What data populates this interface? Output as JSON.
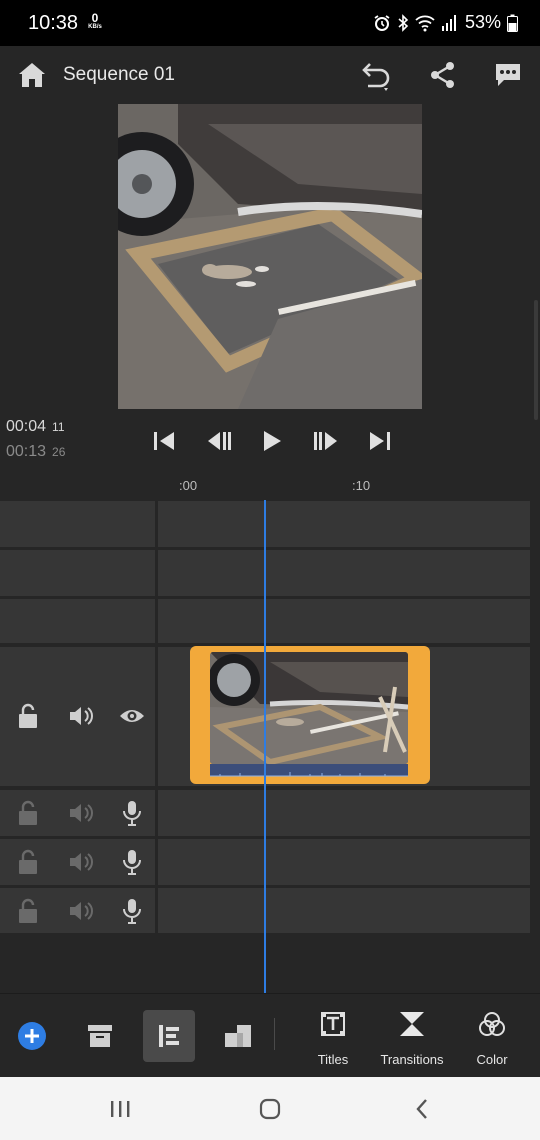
{
  "status_bar": {
    "time": "10:38",
    "net_speed": "0",
    "net_unit": "KB/s",
    "battery": "53%",
    "icons": [
      "alarm-icon",
      "bluetooth-icon",
      "wifi-icon",
      "signal-icon",
      "battery-icon"
    ]
  },
  "app_bar": {
    "title": "Sequence 01",
    "icons": [
      "home-icon",
      "undo-icon",
      "share-icon",
      "comment-icon"
    ]
  },
  "preview": {
    "current_time": "00:04",
    "current_frame": "11",
    "total_time": "00:13",
    "total_frame": "26",
    "transport_icons": [
      "skip-to-start-icon",
      "step-back-icon",
      "play-icon",
      "step-forward-icon",
      "skip-to-end-icon"
    ]
  },
  "ruler": {
    "ticks": [
      ":00",
      ":10"
    ]
  },
  "timeline": {
    "playhead_position_seconds": 4.4,
    "video_track_icons": [
      "lock-icon",
      "speaker-icon",
      "eye-icon"
    ],
    "audio_track_icons": [
      "lock-icon",
      "speaker-icon",
      "mic-icon"
    ],
    "audio_track_count": 3,
    "clip_color": "#f2a93b",
    "playhead_color": "#2e7de3"
  },
  "toolbar": {
    "titles_label": "Titles",
    "transitions_label": "Transitions",
    "color_label": "Color",
    "icons": [
      "add-icon",
      "project-panel-icon",
      "track-panel-icon",
      "crop-icon"
    ]
  },
  "accent_color": "#2e7de3"
}
